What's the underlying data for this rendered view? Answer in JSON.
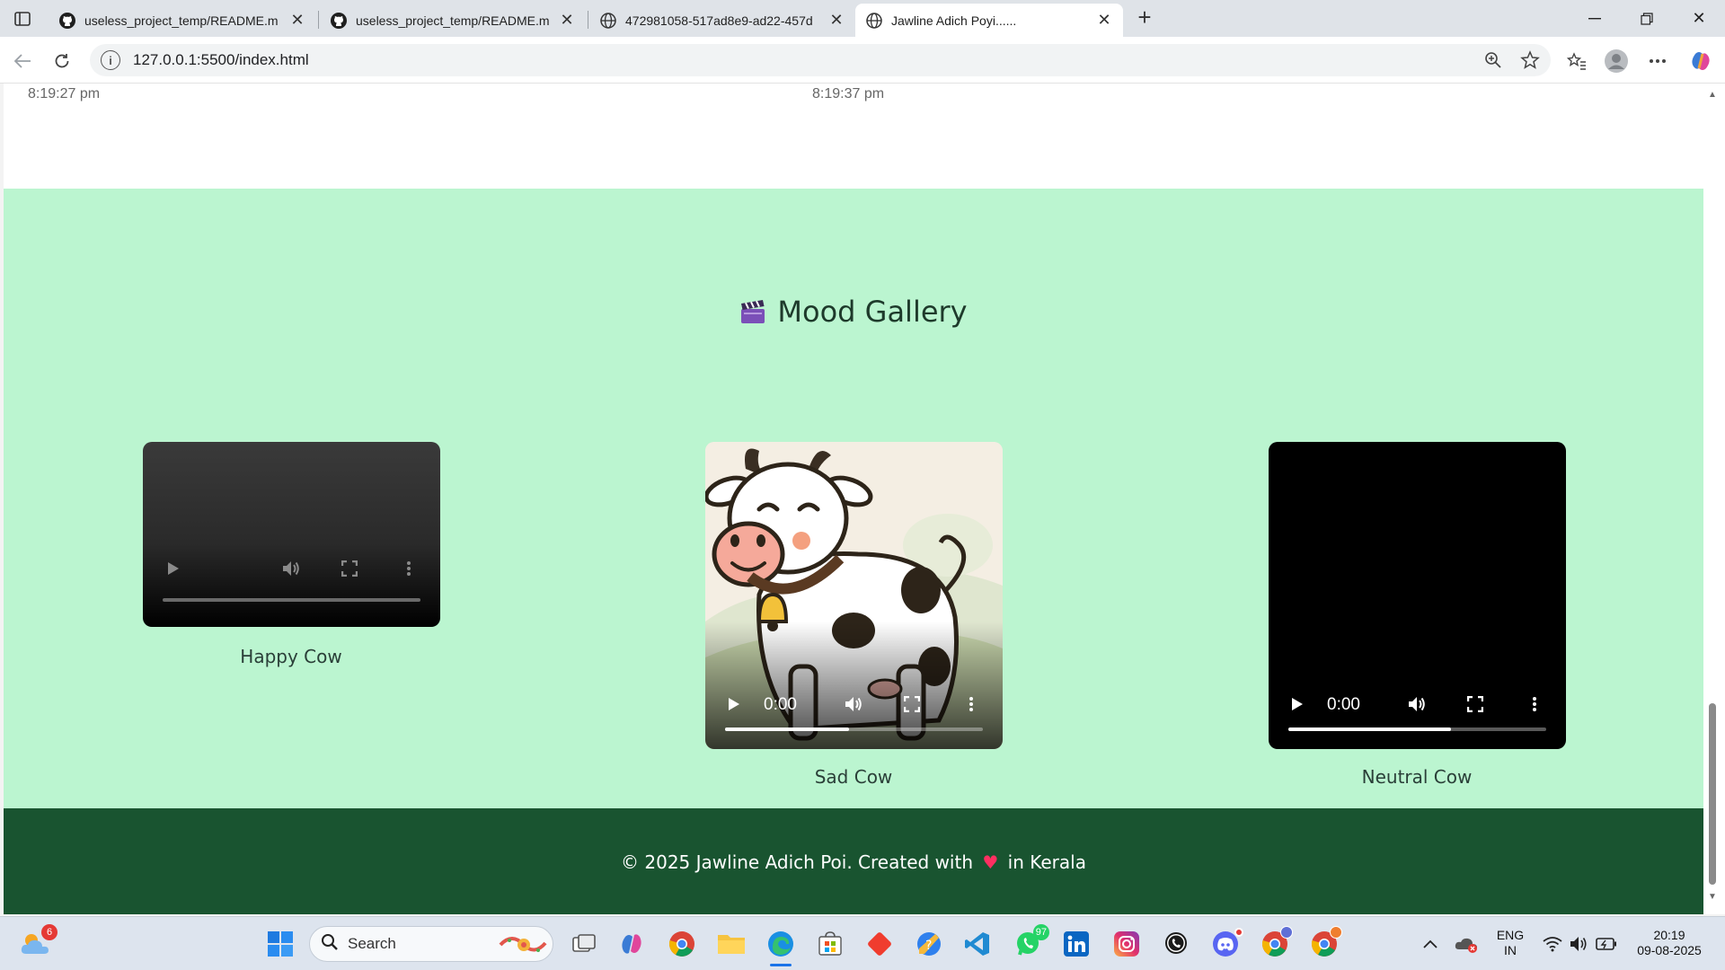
{
  "browser": {
    "tabs": [
      {
        "title": "useless_project_temp/README.m",
        "favicon": "github-icon",
        "active": false
      },
      {
        "title": "useless_project_temp/README.m",
        "favicon": "github-icon",
        "active": false
      },
      {
        "title": "472981058-517ad8e9-ad22-457d",
        "favicon": "globe-icon",
        "active": false
      },
      {
        "title": "Jawline Adich Poyi......",
        "favicon": "globe-icon",
        "active": true
      }
    ],
    "url": "127.0.0.1:5500/index.html"
  },
  "page": {
    "timestamps": [
      "8:19:27 pm",
      "8:19:37 pm"
    ],
    "gallery": {
      "title": "Mood Gallery",
      "videos": [
        {
          "label": "Happy Cow",
          "state": "no-poster",
          "time": "",
          "progress": 0
        },
        {
          "label": "Sad Cow",
          "state": "poster",
          "time": "0:00",
          "progress": 0.48
        },
        {
          "label": "Neutral Cow",
          "state": "black",
          "time": "0:00",
          "progress": 0.63
        }
      ]
    },
    "footer": {
      "prefix": "© 2025 Jawline Adich Poi. Created with",
      "suffix": "in Kerala",
      "heart": "♥"
    }
  },
  "taskbar": {
    "weather_badge": "6",
    "search_placeholder": "Search",
    "whatsapp_badge": "97",
    "language": "ENG",
    "region": "IN",
    "time": "20:19",
    "date": "09-08-2025"
  },
  "colors": {
    "gallery_bg": "#bbf5d0",
    "footer_bg": "#195430",
    "heart": "#ff2f61"
  }
}
